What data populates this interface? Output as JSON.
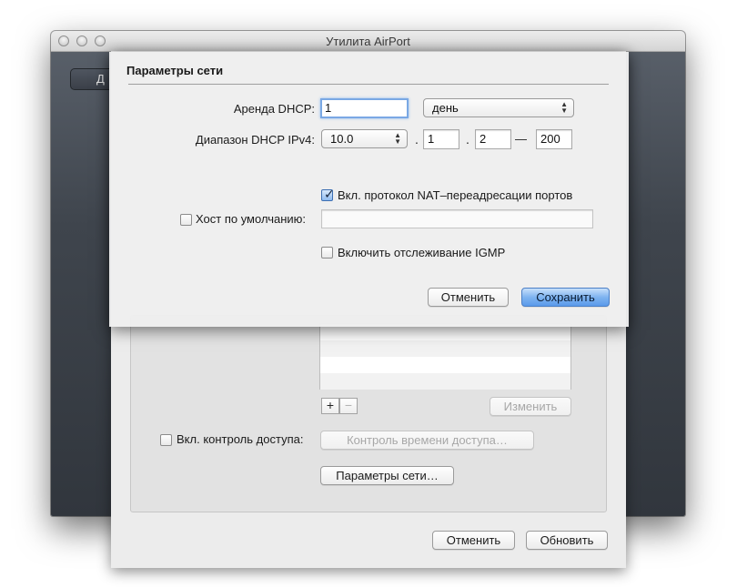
{
  "window": {
    "title": "Утилита AirPort",
    "left_pill_text": "Д"
  },
  "sheet": {
    "access_control_label": "Вкл. контроль доступа:",
    "access_time_button": "Контроль времени доступа…",
    "network_params_button": "Параметры сети…",
    "change_button": "Изменить",
    "add_button": "+",
    "remove_button": "−",
    "cancel_button": "Отменить",
    "update_button": "Обновить"
  },
  "dialog": {
    "title": "Параметры сети",
    "dhcp_lease_label": "Аренда DHCP:",
    "dhcp_lease_value": "1",
    "dhcp_lease_unit": "день",
    "dhcp_range_label": "Диапазон DHCP IPv4:",
    "range_prefix": "10.0",
    "range_octet3": "1",
    "range_start": "2",
    "range_dash": "—",
    "range_end": "200",
    "nat_label": "Вкл. протокол NAT–переадресации портов",
    "nat_checked": true,
    "default_host_label": "Хост по умолчанию:",
    "default_host_checked": false,
    "default_host_value": "",
    "igmp_label": "Включить отслеживание IGMP",
    "igmp_checked": false,
    "cancel_button": "Отменить",
    "save_button": "Сохранить"
  }
}
